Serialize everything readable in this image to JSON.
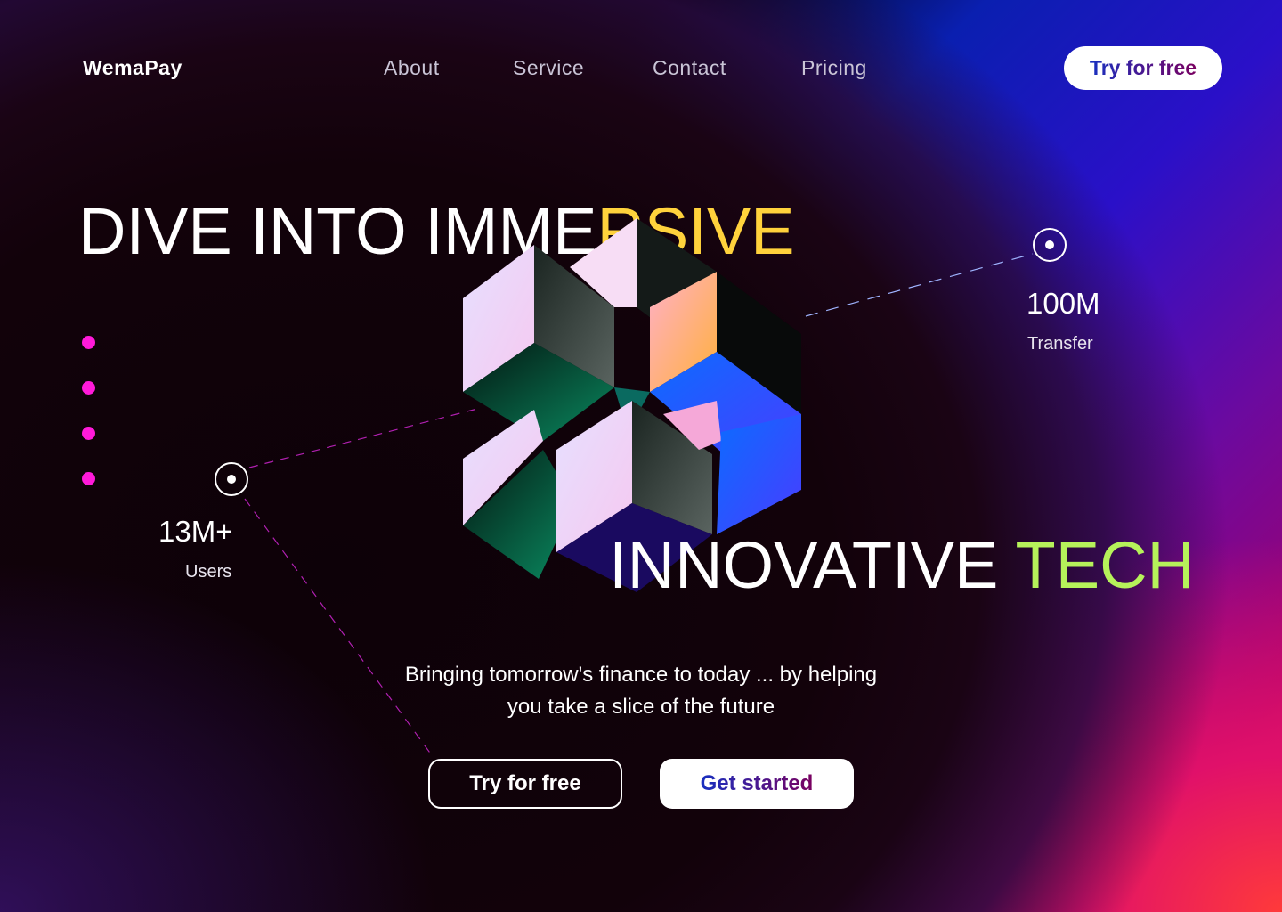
{
  "brand": "WemaPay",
  "nav": [
    {
      "label": "About"
    },
    {
      "label": "Service"
    },
    {
      "label": "Contact"
    },
    {
      "label": "Pricing"
    }
  ],
  "header_cta": "Try for free",
  "headline": {
    "line1_white": "DIVE INTO IMME",
    "line1_accent": "RSIVE",
    "line2_white": "INNOVATIVE ",
    "line2_accent": "TECH"
  },
  "colors": {
    "accent_yellow": "#ffd23c",
    "accent_green": "#b6f25a",
    "dot_pink": "#ff1ad9"
  },
  "stats": [
    {
      "value": "100M",
      "label": "Transfer"
    },
    {
      "value": "13M+",
      "label": "Users"
    }
  ],
  "tagline": "Bringing tomorrow's finance to today ... by helping you take a slice of the future",
  "buttons": {
    "try": "Try for free",
    "start": "Get started"
  }
}
